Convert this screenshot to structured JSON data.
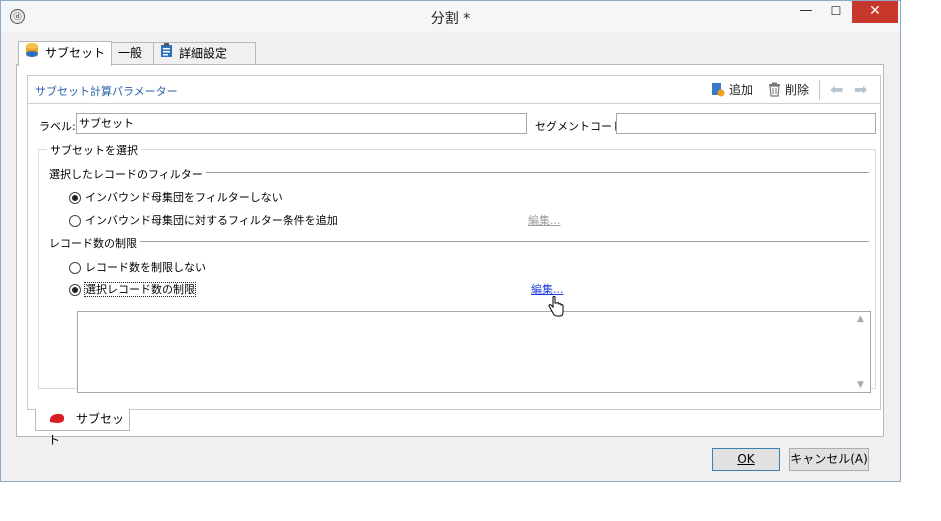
{
  "window": {
    "title": "分割 *",
    "app_icon": "app-logo-icon",
    "min": "—",
    "max": "☐",
    "close": "✕"
  },
  "tabs": [
    {
      "label": "サブセット",
      "icon": "database-icon",
      "active": true
    },
    {
      "label": "一般",
      "active": false
    },
    {
      "label": "詳細設定",
      "icon": "clipboard-icon",
      "active": false
    }
  ],
  "section": {
    "title": "サブセット計算パラメーター"
  },
  "toolbar": {
    "add_label": "追加",
    "delete_label": "削除"
  },
  "form": {
    "label_caption": "ラベル:",
    "label_value": "サブセット",
    "segment_caption": "セグメントコード:",
    "segment_value": ""
  },
  "group": {
    "title": "サブセットを選択",
    "filter_title": "選択したレコードのフィルター",
    "filter_option_1": "インバウンド母集団をフィルターしない",
    "filter_option_2": "インバウンド母集団に対するフィルター条件を追加",
    "filter_edit": "編集...",
    "limit_title": "レコード数の制限",
    "limit_option_1": "レコード数を制限しない",
    "limit_option_2": "選択レコード数の制限",
    "limit_edit": "編集...",
    "filter_selected": 1,
    "limit_selected": 2
  },
  "bottom_tab": {
    "label": "サブセット"
  },
  "buttons": {
    "ok": "OK",
    "cancel": "キャンセル(A)"
  },
  "colors": {
    "close_red": "#c7372b",
    "link_blue": "#1c3fd4",
    "section_blue": "#2a5fa8"
  }
}
